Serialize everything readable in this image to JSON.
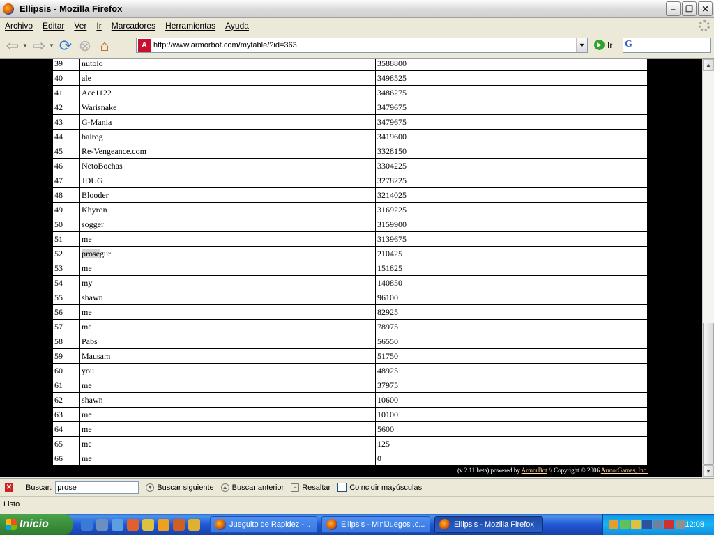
{
  "window": {
    "title": "Ellipsis - Mozilla Firefox"
  },
  "menu": [
    "Archivo",
    "Editar",
    "Ver",
    "Ir",
    "Marcadores",
    "Herramientas",
    "Ayuda"
  ],
  "navbar": {
    "url": "http://www.armorbot.com/mytable/?id=363",
    "go_label": "Ir"
  },
  "table": {
    "rows": [
      {
        "rank": "39",
        "name": "nutolo",
        "score": "3588800"
      },
      {
        "rank": "40",
        "name": "ale",
        "score": "3498525"
      },
      {
        "rank": "41",
        "name": "Ace1122",
        "score": "3486275"
      },
      {
        "rank": "42",
        "name": "Warisnake",
        "score": "3479675"
      },
      {
        "rank": "43",
        "name": "G-Mania",
        "score": "3479675"
      },
      {
        "rank": "44",
        "name": "balrog",
        "score": "3419600"
      },
      {
        "rank": "45",
        "name": "Re-Vengeance.com",
        "score": "3328150"
      },
      {
        "rank": "46",
        "name": "NetoBochas",
        "score": "3304225"
      },
      {
        "rank": "47",
        "name": "JDUG",
        "score": "3278225"
      },
      {
        "rank": "48",
        "name": "Blooder",
        "score": "3214025"
      },
      {
        "rank": "49",
        "name": "Khyron",
        "score": "3169225"
      },
      {
        "rank": "50",
        "name": "sogger",
        "score": "3159900"
      },
      {
        "rank": "51",
        "name": "me",
        "score": "3139675"
      },
      {
        "rank": "52",
        "name": "prosegur",
        "score": "210425"
      },
      {
        "rank": "53",
        "name": "me",
        "score": "151825"
      },
      {
        "rank": "54",
        "name": "my",
        "score": "140850"
      },
      {
        "rank": "55",
        "name": "shawn",
        "score": "96100"
      },
      {
        "rank": "56",
        "name": "me",
        "score": "82925"
      },
      {
        "rank": "57",
        "name": "me",
        "score": "78975"
      },
      {
        "rank": "58",
        "name": "Pabs",
        "score": "56550"
      },
      {
        "rank": "59",
        "name": "Mausam",
        "score": "51750"
      },
      {
        "rank": "60",
        "name": "you",
        "score": "48925"
      },
      {
        "rank": "61",
        "name": "me",
        "score": "37975"
      },
      {
        "rank": "62",
        "name": "shawn",
        "score": "10600"
      },
      {
        "rank": "63",
        "name": "me",
        "score": "10100"
      },
      {
        "rank": "64",
        "name": "me",
        "score": "5600"
      },
      {
        "rank": "65",
        "name": "me",
        "score": "125"
      },
      {
        "rank": "66",
        "name": "me",
        "score": "0"
      }
    ]
  },
  "footer": {
    "prefix": "(v 2.11 beta) powered by ",
    "armorbot": "ArmorBot",
    "middle": " // Copyright © 2006 ",
    "armorgames": "ArmorGames, Inc."
  },
  "findbar": {
    "label": "Buscar:",
    "value": "prose",
    "next": "Buscar siguiente",
    "prev": "Buscar anterior",
    "highlight": "Resaltar",
    "match_case": "Coincidir mayúsculas"
  },
  "status": "Listo",
  "taskbar": {
    "start": "Inicio",
    "tasks": [
      {
        "label": "Jueguito de Rapidez -...",
        "active": false
      },
      {
        "label": "Ellipsis - MiniJuegos .c...",
        "active": false
      },
      {
        "label": "Ellipsis - Mozilla Firefox",
        "active": true
      }
    ],
    "clock": "12:08"
  }
}
